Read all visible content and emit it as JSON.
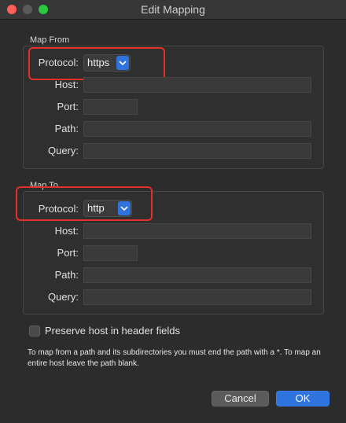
{
  "window": {
    "title": "Edit Mapping"
  },
  "map_from": {
    "group_label": "Map From",
    "protocol_label": "Protocol:",
    "protocol_value": "https",
    "host_label": "Host:",
    "host_value": "",
    "port_label": "Port:",
    "port_value": "",
    "path_label": "Path:",
    "path_value": "",
    "query_label": "Query:",
    "query_value": ""
  },
  "map_to": {
    "group_label": "Map To",
    "protocol_label": "Protocol:",
    "protocol_value": "http",
    "host_label": "Host:",
    "host_value": "",
    "port_label": "Port:",
    "port_value": "",
    "path_label": "Path:",
    "path_value": "",
    "query_label": "Query:",
    "query_value": ""
  },
  "options": {
    "preserve_host_label": "Preserve host in header fields",
    "preserve_host_checked": false
  },
  "note": "To map from a path and its subdirectories you must end the path with a *. To map an entire host leave the path blank.",
  "buttons": {
    "cancel": "Cancel",
    "ok": "OK"
  },
  "colors": {
    "accent": "#2f73df",
    "highlight": "#e5302a",
    "close": "#fe5f57",
    "maximize": "#28c840"
  },
  "icons": {
    "select_arrow": "chevron-down-icon"
  }
}
